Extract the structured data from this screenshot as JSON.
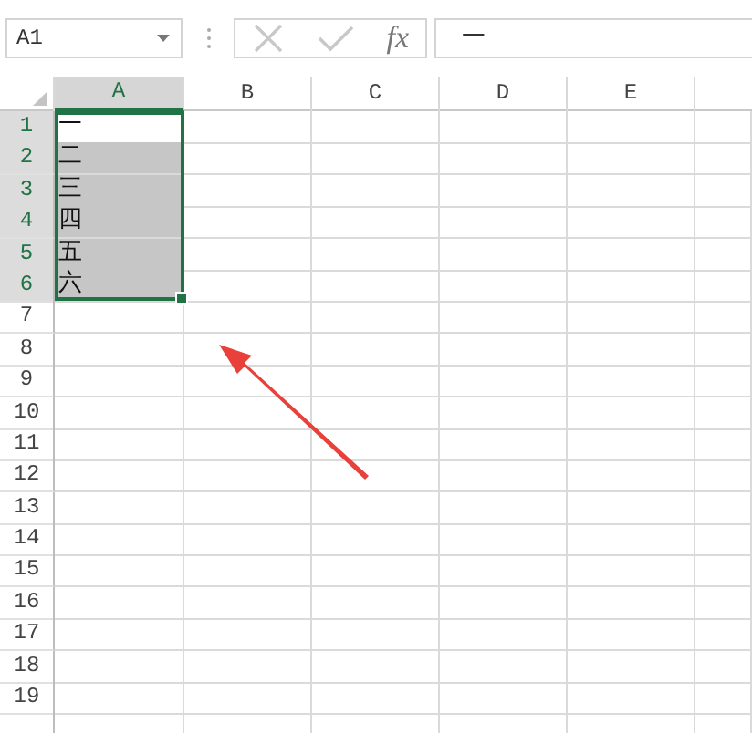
{
  "name_box": {
    "value": "A1"
  },
  "formula_bar": {
    "fx": "fx",
    "value": "一"
  },
  "columns": [
    {
      "label": "A",
      "selected": true
    },
    {
      "label": "B",
      "selected": false
    },
    {
      "label": "C",
      "selected": false
    },
    {
      "label": "D",
      "selected": false
    },
    {
      "label": "E",
      "selected": false
    }
  ],
  "rows": [
    {
      "number": "1",
      "selected": true,
      "cell_a": {
        "value": "一",
        "active": true,
        "selected": true
      }
    },
    {
      "number": "2",
      "selected": true,
      "cell_a": {
        "value": "二",
        "active": false,
        "selected": true
      }
    },
    {
      "number": "3",
      "selected": true,
      "cell_a": {
        "value": "三",
        "active": false,
        "selected": true
      }
    },
    {
      "number": "4",
      "selected": true,
      "cell_a": {
        "value": "四",
        "active": false,
        "selected": true
      }
    },
    {
      "number": "5",
      "selected": true,
      "cell_a": {
        "value": "五",
        "active": false,
        "selected": true
      }
    },
    {
      "number": "6",
      "selected": true,
      "cell_a": {
        "value": "六",
        "active": false,
        "selected": true
      }
    },
    {
      "number": "7",
      "selected": false
    },
    {
      "number": "8",
      "selected": false
    },
    {
      "number": "9",
      "selected": false
    },
    {
      "number": "10",
      "selected": false
    },
    {
      "number": "11",
      "selected": false
    },
    {
      "number": "12",
      "selected": false
    },
    {
      "number": "13",
      "selected": false
    },
    {
      "number": "14",
      "selected": false
    },
    {
      "number": "15",
      "selected": false
    },
    {
      "number": "16",
      "selected": false
    },
    {
      "number": "17",
      "selected": false
    },
    {
      "number": "18",
      "selected": false
    },
    {
      "number": "19",
      "selected": false
    }
  ]
}
